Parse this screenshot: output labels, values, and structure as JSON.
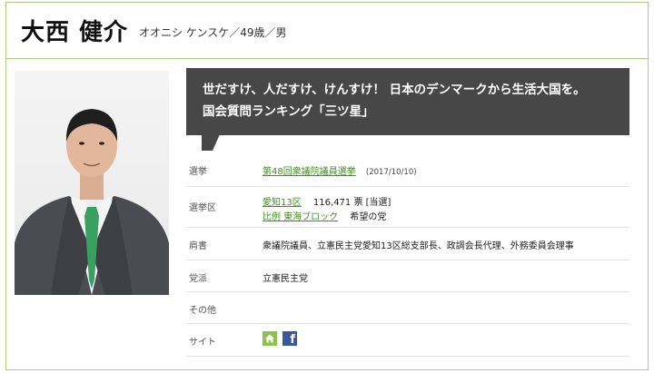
{
  "candidate": {
    "name": "大西 健介",
    "kana_info": "オオニシ ケンスケ／49歳／男"
  },
  "catchphrase": {
    "line1": "世だすけ、人だすけ、けんすけ！ 日本のデンマークから生活大国を。",
    "line2": "国会質問ランキング「三ツ星」"
  },
  "details": {
    "election": {
      "label": "選挙",
      "link": "第48回衆議院議員選挙",
      "date": "(2017/10/10)"
    },
    "district": {
      "label": "選挙区",
      "district_link": "愛知13区",
      "votes": "116,471 票 [当選]",
      "pr_link": "比例 東海ブロック",
      "party": "希望の党"
    },
    "title": {
      "label": "肩書",
      "value": "衆議院議員、立憲民主党愛知13区総支部長、政調会長代理、外務委員会理事"
    },
    "faction": {
      "label": "党派",
      "value": "立憲民主党"
    },
    "other": {
      "label": "その他",
      "value": ""
    },
    "site": {
      "label": "サイト",
      "icons": [
        "home-icon",
        "facebook-icon"
      ]
    }
  },
  "colors": {
    "accent_green": "#a8cf7a",
    "link_green": "#3f8f22",
    "bubble_bg": "#474747",
    "facebook_blue": "#3b5998"
  }
}
